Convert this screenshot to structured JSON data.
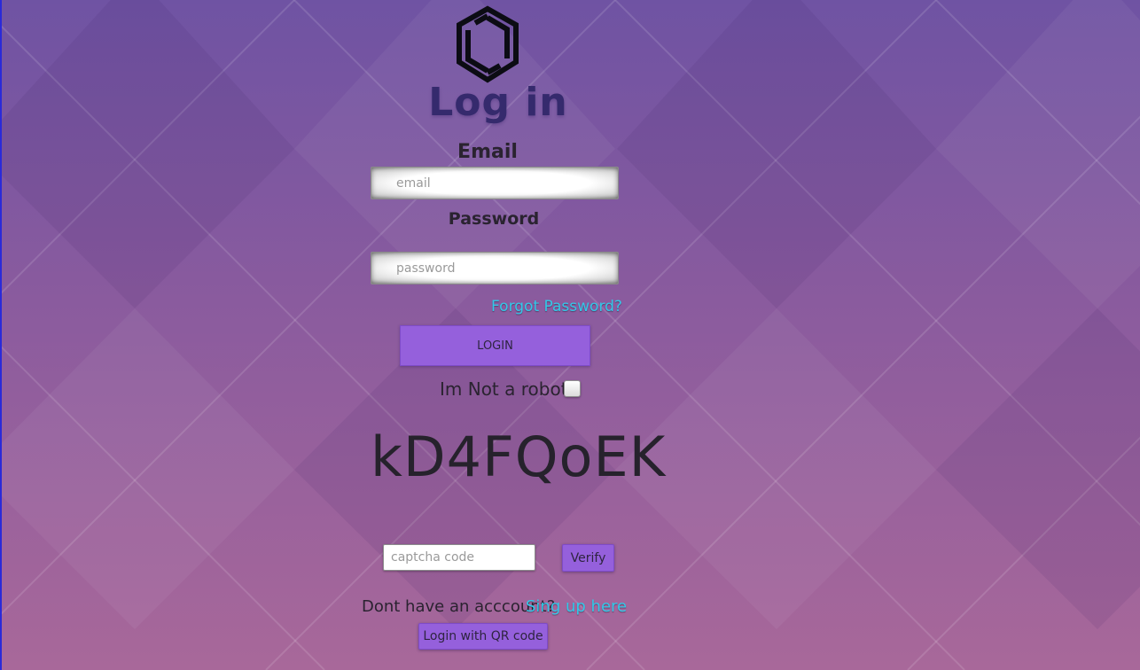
{
  "colors": {
    "background_top": "#6f53a3",
    "background_bottom": "#a8689a",
    "title": "#352a6d",
    "button": "#9560dc",
    "link": "#33c8e8"
  },
  "logo": {
    "icon": "hexagon-logo-icon"
  },
  "title": "Log in",
  "email": {
    "label": "Email",
    "placeholder": "email",
    "value": ""
  },
  "password": {
    "label": "Password",
    "placeholder": "password",
    "value": ""
  },
  "forgot_password": "Forgot Password?",
  "login_button": "LOGIN",
  "robot_check": {
    "label": "Im Not a robot",
    "checked": false
  },
  "captcha": {
    "code": "kD4FQoEK",
    "input_placeholder": "captcha code",
    "verify_button": "Verify"
  },
  "signup": {
    "prompt": "Dont have an acccount?",
    "link": "Sing up here"
  },
  "qr_login_button": "Login with QR code"
}
